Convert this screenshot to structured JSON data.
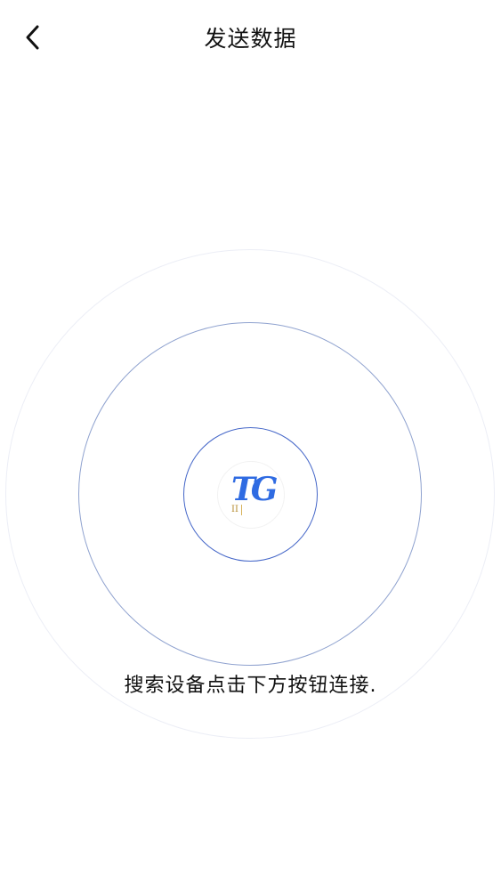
{
  "header": {
    "title": "发送数据",
    "back_icon": "chevron-left-icon"
  },
  "radar": {
    "logo_text": "TG",
    "logo_badge": "II",
    "ring_colors": [
      "#eceef6",
      "#8fa2cf",
      "#4466c8"
    ]
  },
  "status": {
    "message": "搜索设备点击下方按钮连接."
  }
}
